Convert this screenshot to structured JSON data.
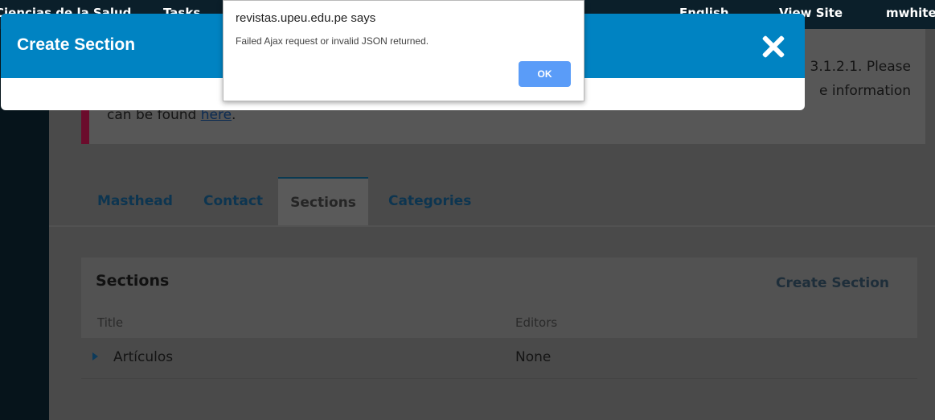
{
  "topbar": {
    "context": "Ciencias de la Salud",
    "tasks_label": "Tasks",
    "language": "English",
    "view_site": "View Site",
    "user": "mwhite"
  },
  "notice": {
    "line1_tail": "3.1.2.1. Please",
    "line2_tail": "e information",
    "line3_prefix": "can be found ",
    "link": "here",
    "line3_suffix": "."
  },
  "tabs": [
    {
      "label": "Masthead"
    },
    {
      "label": "Contact"
    },
    {
      "label": "Sections"
    },
    {
      "label": "Categories"
    }
  ],
  "sections_panel": {
    "title": "Sections",
    "create_link": "Create Section",
    "columns": [
      "Title",
      "Editors"
    ],
    "rows": [
      {
        "title": "Artículos",
        "editors": "None"
      }
    ]
  },
  "modal": {
    "title": "Create Section"
  },
  "alert": {
    "title": "revistas.upeu.edu.pe says",
    "message": "Failed Ajax request or invalid JSON returned.",
    "ok_label": "OK",
    "ok_color": "#5a9cf8"
  },
  "colors": {
    "header_blue": "#0083c2",
    "topbar": "#0b1f2a"
  }
}
